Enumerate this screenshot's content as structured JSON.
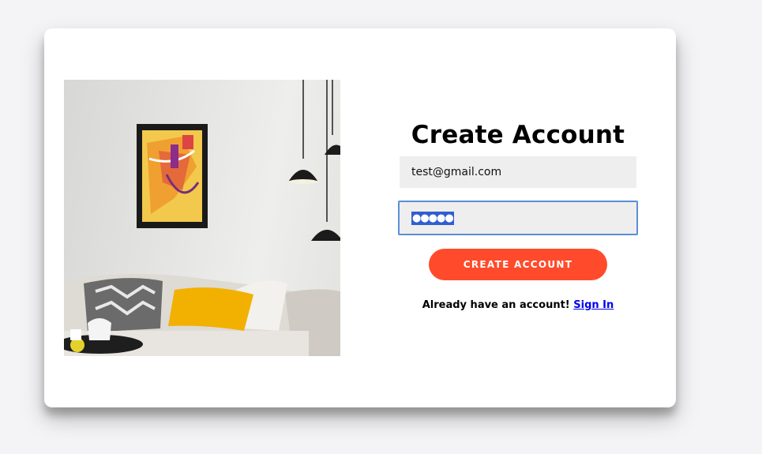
{
  "form": {
    "title": "Create Account",
    "email_value": "test@gmail.com",
    "password_masked": "●●●●●",
    "submit_label": "CREATE ACCOUNT",
    "signin_prompt": "Already have an account!",
    "signin_link": "Sign In"
  },
  "illustration": {
    "subject": "living room with framed abstract painting, white sofa, yellow cushion and black pendant lamps"
  },
  "colors": {
    "accent": "#ff4b2b",
    "page_bg": "#f4f4f6",
    "input_bg": "#eeeeee",
    "focus_border": "#5b8ed6",
    "link": "#0000ee"
  }
}
